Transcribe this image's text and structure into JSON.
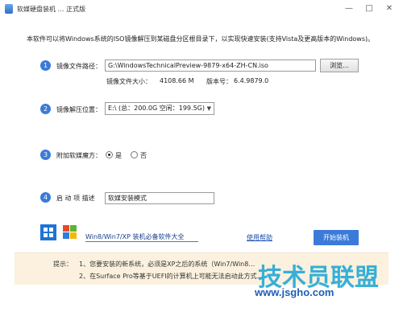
{
  "window": {
    "title": "软媒硬盘装机 … 正式版",
    "minimize_glyph": "—",
    "maximize_glyph": "□",
    "close_glyph": "✕"
  },
  "description": "本软件可以将Windows系统的ISO镜像解压到某磁盘分区根目录下，以实现快速安装(支持Vista及更高版本的Windows)。",
  "steps": [
    {
      "number": "1",
      "label": "镜像文件路径：",
      "value": "G:\\WindowsTechnicalPreview-9879-x64-ZH-CN.iso",
      "browse_label": "浏览...",
      "size_label": "镜像文件大小：",
      "size_value": "4108.66 M",
      "version_label": "版本号：",
      "version_value": "6.4.9879.0"
    },
    {
      "number": "2",
      "label": "镜像解压位置：",
      "selected": "E:\\ (总：200.0G 空闲：199.5G)"
    },
    {
      "number": "3",
      "label": "附加软媒魔方：",
      "options": [
        "是",
        "否"
      ],
      "selected_index": 0
    },
    {
      "number": "4",
      "label": "启 动 项 描述",
      "value": "软媒安装模式"
    }
  ],
  "footer": {
    "promo": "Win8/Win7/XP 装机必备软件大全",
    "help": "使用帮助",
    "start": "开始装机"
  },
  "tip": {
    "label": "提示：",
    "line1": "1、您要安装的新系统，必须是XP之后的系统（Win7/Win8…",
    "line2": "2、在Surface Pro等基于UEFI的计算机上可能无法启动此方式…"
  },
  "watermark": {
    "cn": "技术员联盟",
    "url": "www.jsgho.com"
  },
  "colors": {
    "accent": "#3b7ad8",
    "tip_bg": "#fbf1de",
    "link": "#1a4fb0"
  }
}
